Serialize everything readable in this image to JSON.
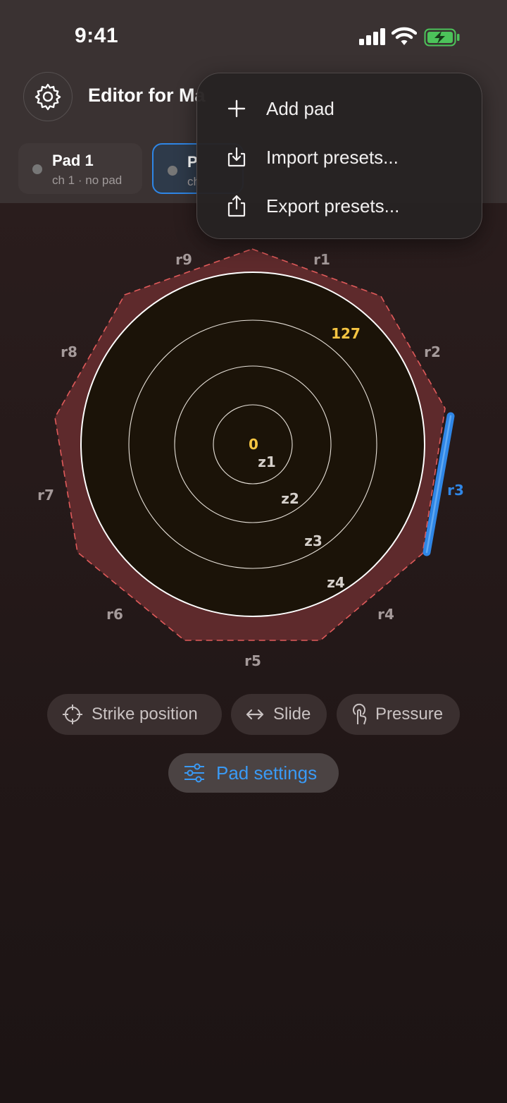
{
  "status_bar": {
    "time": "9:41"
  },
  "header": {
    "title": "Editor for Ma"
  },
  "pads": [
    {
      "name": "Pad 1",
      "subtitle": "ch 1 · no pad"
    },
    {
      "name": "P",
      "subtitle": "ch"
    }
  ],
  "menu": {
    "items": [
      {
        "label": "Add pad",
        "icon": "plus-icon"
      },
      {
        "label": "Import presets...",
        "icon": "import-icon"
      },
      {
        "label": "Export presets...",
        "icon": "export-icon"
      }
    ]
  },
  "drum": {
    "rims": [
      "r1",
      "r2",
      "r3",
      "r4",
      "r5",
      "r6",
      "r7",
      "r8",
      "r9"
    ],
    "selected_rim": "r3",
    "zones": [
      "z1",
      "z2",
      "z3",
      "z4"
    ],
    "center_value": "0",
    "edge_value": "127"
  },
  "actions": {
    "strike": "Strike position",
    "slide": "Slide",
    "pressure": "Pressure",
    "settings": "Pad settings"
  },
  "colors": {
    "accent": "#2f86e6",
    "rim_fill": "#5e2a2c",
    "rim_stroke": "#e05a5a",
    "value_yellow": "#f5c542"
  }
}
